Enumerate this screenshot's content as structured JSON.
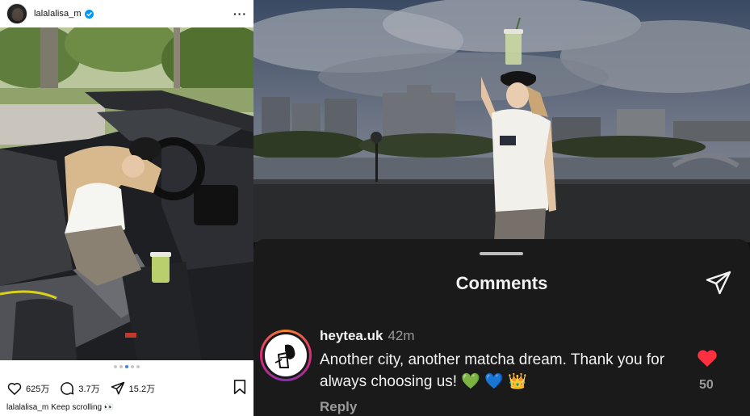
{
  "post": {
    "username": "lalalalisa_m",
    "verified": true,
    "likes_count": "625万",
    "comments_count": "3.7万",
    "shares_count": "15.2万",
    "carousel": {
      "total": 5,
      "active": 2
    },
    "caption": {
      "username": "lalalalisa_m",
      "text": "Keep scrolling 👀"
    }
  },
  "comments_sheet": {
    "title": "Comments",
    "comment": {
      "username": "heytea.uk",
      "time": "42m",
      "text": "Another city, another matcha dream. Thank you for always choosing us!",
      "emojis": [
        "💚",
        "💙",
        "👑"
      ],
      "reply_label": "Reply",
      "like_count": "50"
    }
  },
  "colors": {
    "like_red": "#ff3040",
    "verified_blue": "#0095f6",
    "sheet_bg": "#1a1a1a",
    "muted_text": "#9a9a9a"
  }
}
